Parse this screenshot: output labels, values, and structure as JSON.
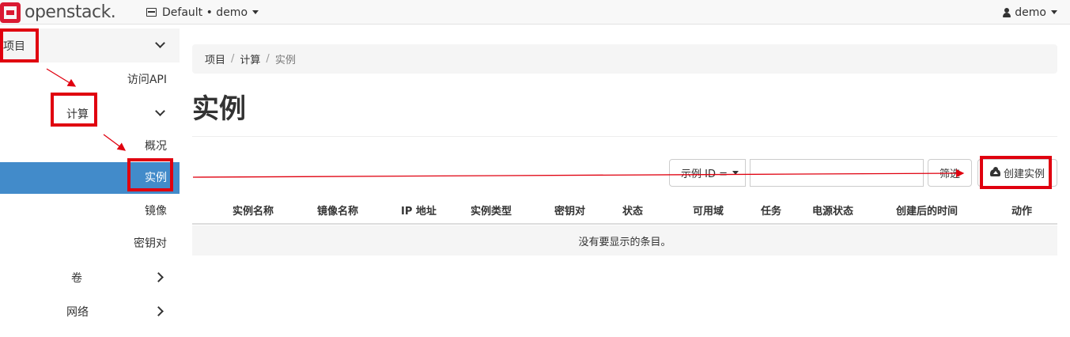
{
  "navbar": {
    "logo_text": "openstack.",
    "project_picker": "Default • demo",
    "user": "demo"
  },
  "sidebar": {
    "project": "项目",
    "access_api": "访问API",
    "compute": "计算",
    "overview": "概况",
    "instances": "实例",
    "images": "镜像",
    "key_pairs": "密钥对",
    "volumes": "卷",
    "network": "网络"
  },
  "breadcrumb": {
    "items": [
      "项目",
      "计算",
      "实例"
    ]
  },
  "page": {
    "title": "实例"
  },
  "toolbar": {
    "filter_field": "示例 ID =",
    "filter_value": "",
    "filter_button": "筛选",
    "create_button": "创建实例"
  },
  "table": {
    "columns": [
      "实例名称",
      "镜像名称",
      "IP 地址",
      "实例类型",
      "密钥对",
      "状态",
      "可用域",
      "任务",
      "电源状态",
      "创建后的时间",
      "动作"
    ],
    "empty_message": "没有要显示的条目。"
  },
  "colors": {
    "active_nav": "#428bca",
    "annotation_red": "#e0000f",
    "brand_red": "#da1a32"
  }
}
